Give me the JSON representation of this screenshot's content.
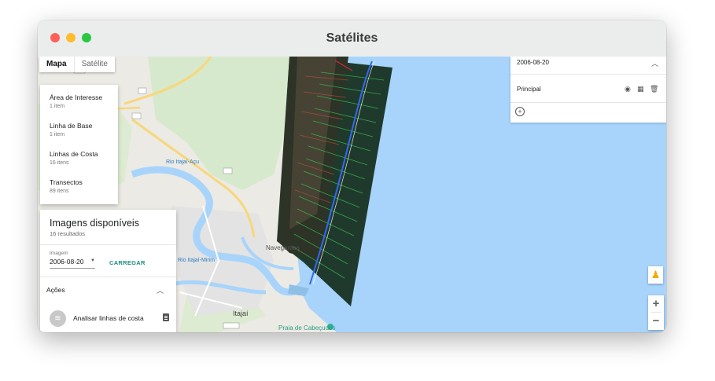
{
  "window": {
    "title": "Satélites"
  },
  "map_type": {
    "map": "Mapa",
    "satellite": "Satélite"
  },
  "layers": [
    {
      "name": "Área de Interesse",
      "count": "1 item"
    },
    {
      "name": "Linha de Base",
      "count": "1 item"
    },
    {
      "name": "Linhas de Costa",
      "count": "16 itens"
    },
    {
      "name": "Transectos",
      "count": "89 itens"
    }
  ],
  "images_panel": {
    "title": "Imagens disponíveis",
    "subtitle": "16 resultados",
    "image_label": "Imagem",
    "image_value": "2006-08-20",
    "load_button": "CARREGAR",
    "actions_label": "Ações",
    "action_item": "Analisar linhas de costa"
  },
  "right_panel": {
    "date": "2006-08-20",
    "layer_name": "Principal"
  },
  "map_labels": {
    "city": "Itajaí",
    "navegantes": "Navegantes",
    "beach": "Praia de Cabeçudos",
    "river": "Rio Itajaí-Açu",
    "river2": "Rio Itajaí-Mirim"
  },
  "map_controls": {
    "zoom_in": "+",
    "zoom_out": "−"
  }
}
